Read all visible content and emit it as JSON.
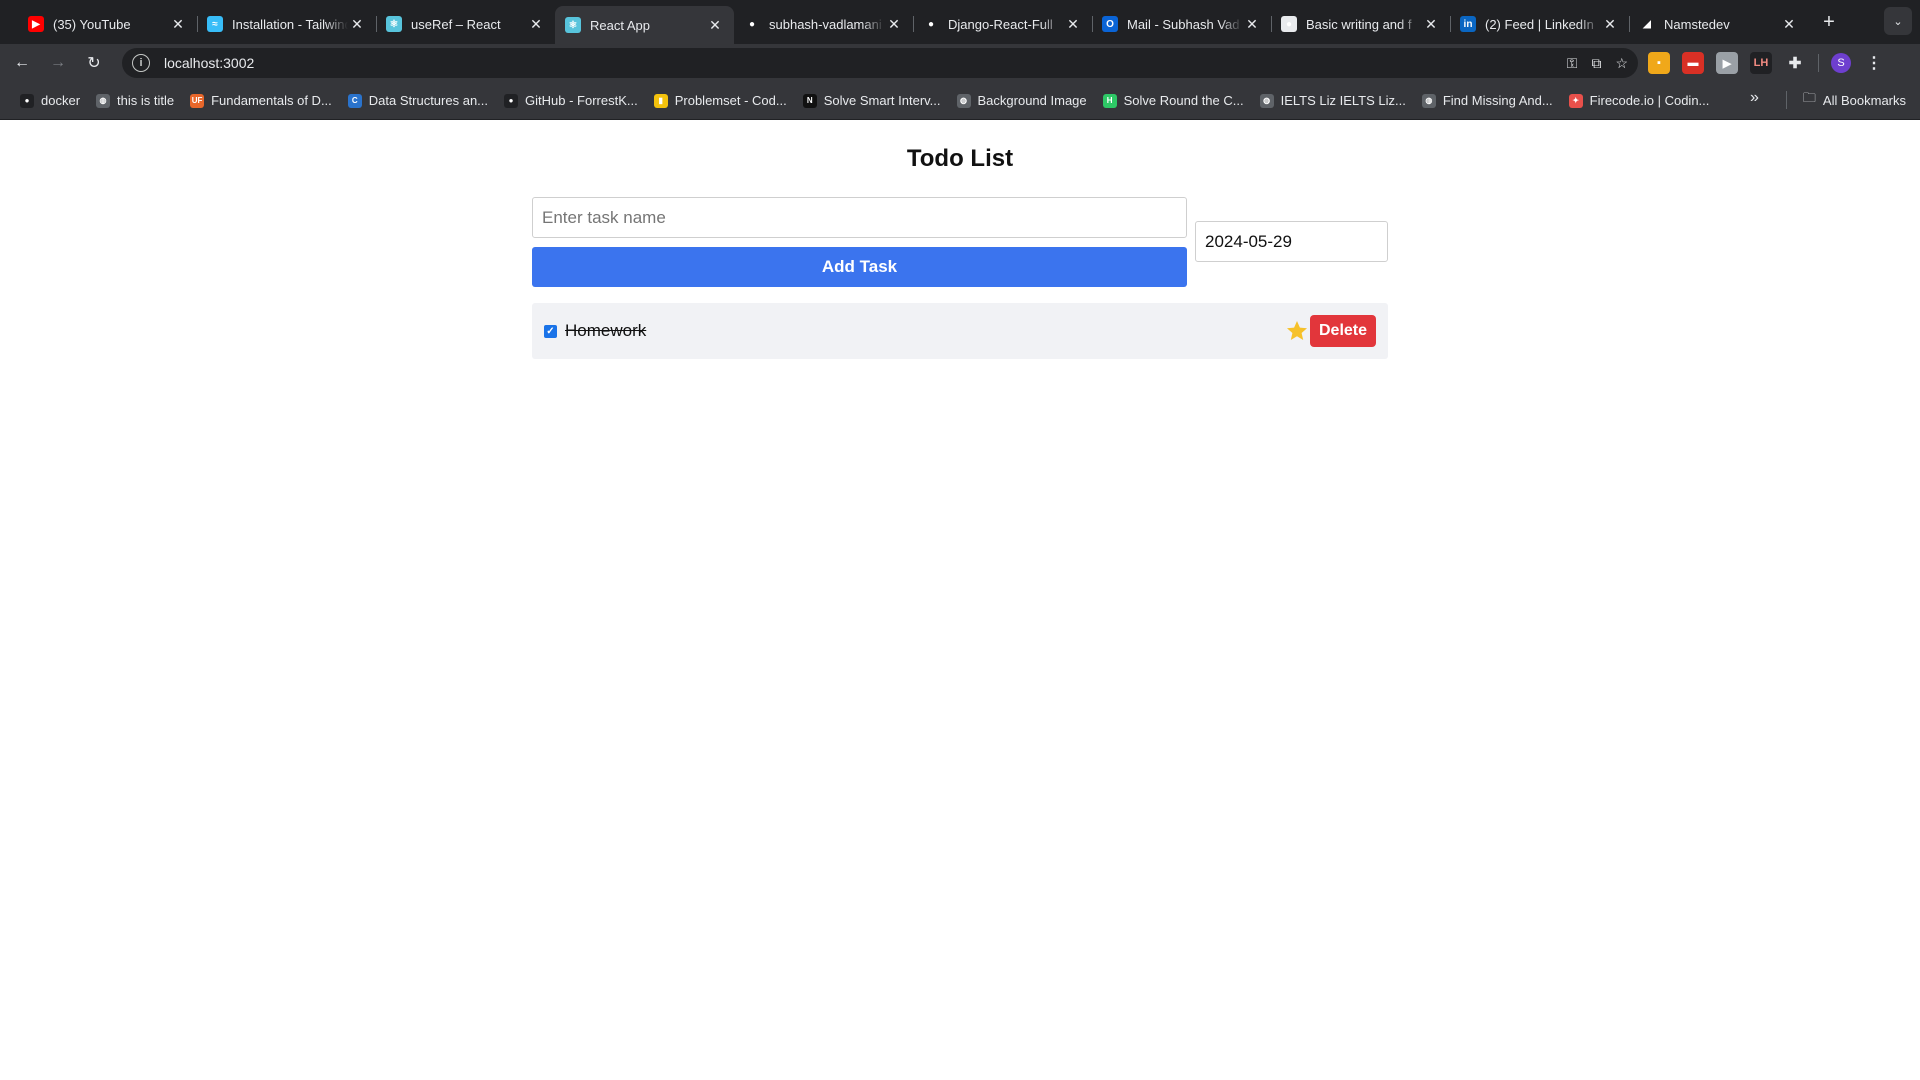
{
  "browser": {
    "tabs": [
      {
        "title": "(35) YouTube",
        "icon": "youtube-icon",
        "color": "#ff0000",
        "glyph": "▶"
      },
      {
        "title": "Installation - Tailwind",
        "icon": "tailwind-icon",
        "color": "#38bdf8",
        "glyph": "≈"
      },
      {
        "title": "useRef – React",
        "icon": "react-icon",
        "color": "#58c4dc",
        "glyph": "⚛"
      },
      {
        "title": "React App",
        "icon": "react-icon",
        "color": "#58c4dc",
        "glyph": "⚛"
      },
      {
        "title": "subhash-vadlamani",
        "icon": "github-icon",
        "color": "#202124",
        "glyph": "●"
      },
      {
        "title": "Django-React-Full",
        "icon": "github-icon",
        "color": "#202124",
        "glyph": "●"
      },
      {
        "title": "Mail - Subhash Vad",
        "icon": "outlook-icon",
        "color": "#0a64d6",
        "glyph": "O"
      },
      {
        "title": "Basic writing and f",
        "icon": "github-icon",
        "color": "#e8eaed",
        "glyph": "●"
      },
      {
        "title": "(2) Feed | LinkedIn",
        "icon": "linkedin-icon",
        "color": "#0a66c2",
        "glyph": "in"
      },
      {
        "title": "Namstedev",
        "icon": "namastedev-icon",
        "color": "#202124",
        "glyph": "◢"
      }
    ],
    "url": "localhost:3002",
    "bookmarks": [
      {
        "label": "docker",
        "icon": "github-icon",
        "color": "#202124",
        "glyph": "●"
      },
      {
        "label": "this is title",
        "icon": "globe-icon",
        "color": "#5f6368",
        "glyph": "◍"
      },
      {
        "label": "Fundamentals of D...",
        "icon": "uf-icon",
        "color": "#e8672b",
        "glyph": "UF"
      },
      {
        "label": "Data Structures an...",
        "icon": "coursera-icon",
        "color": "#2a73cc",
        "glyph": "C"
      },
      {
        "label": "GitHub - ForrestK...",
        "icon": "github-icon",
        "color": "#202124",
        "glyph": "●"
      },
      {
        "label": "Problemset - Cod...",
        "icon": "codeforces-icon",
        "color": "#f4c20d",
        "glyph": "▮"
      },
      {
        "label": "Solve Smart Interv...",
        "icon": "naukri-icon",
        "color": "#111111",
        "glyph": "N"
      },
      {
        "label": "Background Image",
        "icon": "globe-icon",
        "color": "#5f6368",
        "glyph": "◍"
      },
      {
        "label": "Solve Round the C...",
        "icon": "hackerrank-icon",
        "color": "#2ec866",
        "glyph": "H"
      },
      {
        "label": "IELTS Liz IELTS Liz...",
        "icon": "globe-icon",
        "color": "#5f6368",
        "glyph": "◍"
      },
      {
        "label": "Find Missing And...",
        "icon": "globe-icon",
        "color": "#5f6368",
        "glyph": "◍"
      },
      {
        "label": "Firecode.io | Codin...",
        "icon": "firecode-icon",
        "color": "#e8504b",
        "glyph": "✦"
      }
    ],
    "all_bookmarks": "All Bookmarks",
    "profile_initial": "S"
  },
  "app": {
    "title": "Todo List",
    "task_input": {
      "value": "",
      "placeholder": "Enter task name"
    },
    "date_value": "2024-05-29",
    "add_button": "Add Task",
    "tasks": [
      {
        "name": "Homework",
        "completed": true,
        "starred": true,
        "delete_label": "Delete"
      }
    ]
  },
  "colors": {
    "primary": "#3b74ee",
    "danger": "#e2363b",
    "star": "#f6c12a",
    "item_bg": "#f1f2f5"
  }
}
